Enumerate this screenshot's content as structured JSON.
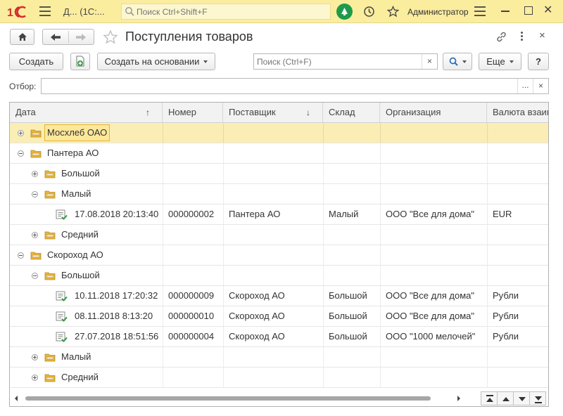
{
  "window": {
    "title": "Д... (1С:...",
    "search_placeholder": "Поиск Ctrl+Shift+F",
    "user": "Администратор",
    "close_glyph": "✕"
  },
  "form": {
    "title": "Поступления товаров",
    "close_glyph": "×"
  },
  "toolbar": {
    "create_label": "Создать",
    "create_based_label": "Создать на основании",
    "search_placeholder": "Поиск (Ctrl+F)",
    "more_label": "Еще",
    "help_label": "?",
    "clear_glyph": "×"
  },
  "filter": {
    "label": "Отбор:",
    "value": "",
    "select_glyph": "...",
    "clear_glyph": "×"
  },
  "table": {
    "columns": [
      {
        "label": "Дата",
        "sort": "↑"
      },
      {
        "label": "Номер",
        "sort": ""
      },
      {
        "label": "Поставщик",
        "sort": "↓"
      },
      {
        "label": "Склад",
        "sort": ""
      },
      {
        "label": "Организация",
        "sort": ""
      },
      {
        "label": "Валюта взаим",
        "sort": ""
      }
    ],
    "rows": [
      {
        "type": "group",
        "level": 0,
        "expanded": false,
        "selected": true,
        "label": "Мосхлеб ОАО"
      },
      {
        "type": "group",
        "level": 0,
        "expanded": true,
        "selected": false,
        "label": "Пантера АО"
      },
      {
        "type": "group",
        "level": 1,
        "expanded": false,
        "selected": false,
        "label": "Большой"
      },
      {
        "type": "group",
        "level": 1,
        "expanded": true,
        "selected": false,
        "label": "Малый"
      },
      {
        "type": "doc",
        "level": 2,
        "date": "17.08.2018 20:13:40",
        "number": "000000002",
        "supplier": "Пантера АО",
        "warehouse": "Малый",
        "org": "ООО \"Все для дома\"",
        "currency": "EUR"
      },
      {
        "type": "group",
        "level": 1,
        "expanded": false,
        "selected": false,
        "label": "Средний"
      },
      {
        "type": "group",
        "level": 0,
        "expanded": true,
        "selected": false,
        "label": "Скороход АО"
      },
      {
        "type": "group",
        "level": 1,
        "expanded": true,
        "selected": false,
        "label": "Большой"
      },
      {
        "type": "doc",
        "level": 2,
        "date": "10.11.2018 17:20:32",
        "number": "000000009",
        "supplier": "Скороход АО",
        "warehouse": "Большой",
        "org": "ООО \"Все для дома\"",
        "currency": "Рубли"
      },
      {
        "type": "doc",
        "level": 2,
        "date": "08.11.2018 8:13:20",
        "number": "000000010",
        "supplier": "Скороход АО",
        "warehouse": "Большой",
        "org": "ООО \"Все для дома\"",
        "currency": "Рубли"
      },
      {
        "type": "doc",
        "level": 2,
        "date": "27.07.2018 18:51:56",
        "number": "000000004",
        "supplier": "Скороход АО",
        "warehouse": "Большой",
        "org": "ООО \"1000 мелочей\"",
        "currency": "Рубли"
      },
      {
        "type": "group",
        "level": 1,
        "expanded": false,
        "selected": false,
        "label": "Малый"
      },
      {
        "type": "group",
        "level": 1,
        "expanded": false,
        "selected": false,
        "label": "Средний"
      }
    ]
  },
  "colors": {
    "titlebar_bg": "#fbed9e",
    "selection_bg": "#fbeeb5",
    "notification": "#1f9a4b",
    "logo_red": "#d32f2f",
    "folder_yellow": "#e8b737",
    "doc_check_green": "#2e9e3e"
  },
  "icons": [
    "1c-logo-icon",
    "menu-icon",
    "search-icon",
    "notification-bell-icon",
    "history-icon",
    "star-icon",
    "home-icon",
    "back-arrow-icon",
    "forward-arrow-icon",
    "link-icon",
    "more-vertical-icon",
    "close-icon",
    "copy-doc-icon",
    "folder-icon",
    "posted-doc-icon"
  ]
}
